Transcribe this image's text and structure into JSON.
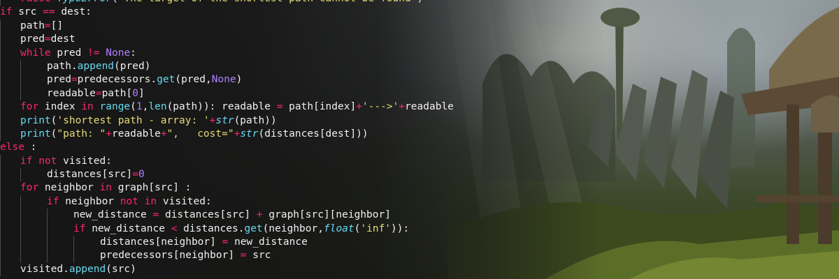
{
  "colors": {
    "keyword": "#f92672",
    "function": "#66d9ef",
    "string": "#e6db74",
    "number": "#ae81ff",
    "text": "#f0f0f0"
  },
  "code": {
    "lines": [
      {
        "indent": 1,
        "tokens": [
          [
            "kw",
            "raise "
          ],
          [
            "bi",
            "TypeError"
          ],
          [
            "txt",
            "("
          ],
          [
            "str",
            "'The target of the shortest path cannot be found'"
          ],
          [
            "txt",
            ")"
          ]
        ]
      },
      {
        "indent": 0,
        "tokens": [
          [
            "kw",
            "if "
          ],
          [
            "txt",
            "src "
          ],
          [
            "op",
            "=="
          ],
          [
            "txt",
            " dest:"
          ]
        ]
      },
      {
        "indent": 1,
        "tokens": [
          [
            "txt",
            "path"
          ],
          [
            "op",
            "="
          ],
          [
            "txt",
            "[]"
          ]
        ]
      },
      {
        "indent": 1,
        "tokens": [
          [
            "txt",
            "pred"
          ],
          [
            "op",
            "="
          ],
          [
            "txt",
            "dest"
          ]
        ]
      },
      {
        "indent": 1,
        "tokens": [
          [
            "kw",
            "while "
          ],
          [
            "txt",
            "pred "
          ],
          [
            "op",
            "!="
          ],
          [
            "txt",
            " "
          ],
          [
            "const",
            "None"
          ],
          [
            "txt",
            ":"
          ]
        ]
      },
      {
        "indent": 2,
        "tokens": [
          [
            "txt",
            "path."
          ],
          [
            "fn",
            "append"
          ],
          [
            "txt",
            "(pred)"
          ]
        ]
      },
      {
        "indent": 2,
        "tokens": [
          [
            "txt",
            "pred"
          ],
          [
            "op",
            "="
          ],
          [
            "txt",
            "predecessors."
          ],
          [
            "fn",
            "get"
          ],
          [
            "txt",
            "(pred,"
          ],
          [
            "const",
            "None"
          ],
          [
            "txt",
            ")"
          ]
        ]
      },
      {
        "indent": 2,
        "tokens": [
          [
            "txt",
            "readable"
          ],
          [
            "op",
            "="
          ],
          [
            "txt",
            "path["
          ],
          [
            "num",
            "0"
          ],
          [
            "txt",
            "]"
          ]
        ]
      },
      {
        "indent": 1,
        "tokens": [
          [
            "kw",
            "for "
          ],
          [
            "txt",
            "index "
          ],
          [
            "kw",
            "in "
          ],
          [
            "fn",
            "range"
          ],
          [
            "txt",
            "("
          ],
          [
            "num",
            "1"
          ],
          [
            "txt",
            ","
          ],
          [
            "fn",
            "len"
          ],
          [
            "txt",
            "(path)): readable "
          ],
          [
            "op",
            "="
          ],
          [
            "txt",
            " path[index]"
          ],
          [
            "op",
            "+"
          ],
          [
            "str",
            "'--->'"
          ],
          [
            "op",
            "+"
          ],
          [
            "txt",
            "readable"
          ]
        ]
      },
      {
        "indent": 1,
        "tokens": [
          [
            "fn",
            "print"
          ],
          [
            "txt",
            "("
          ],
          [
            "str",
            "'shortest path - array: '"
          ],
          [
            "op",
            "+"
          ],
          [
            "bi",
            "str"
          ],
          [
            "txt",
            "(path))"
          ]
        ]
      },
      {
        "indent": 1,
        "tokens": [
          [
            "fn",
            "print"
          ],
          [
            "txt",
            "("
          ],
          [
            "str",
            "\"path: \""
          ],
          [
            "op",
            "+"
          ],
          [
            "txt",
            "readable"
          ],
          [
            "op",
            "+"
          ],
          [
            "str",
            "\",   cost=\""
          ],
          [
            "op",
            "+"
          ],
          [
            "bi",
            "str"
          ],
          [
            "txt",
            "(distances[dest]))"
          ]
        ]
      },
      {
        "indent": 0,
        "tokens": [
          [
            "kw",
            "else "
          ],
          [
            "txt",
            ":"
          ]
        ]
      },
      {
        "indent": 1,
        "tokens": [
          [
            "kw",
            "if not "
          ],
          [
            "txt",
            "visited:"
          ]
        ]
      },
      {
        "indent": 2,
        "tokens": [
          [
            "txt",
            "distances[src]"
          ],
          [
            "op",
            "="
          ],
          [
            "num",
            "0"
          ]
        ]
      },
      {
        "indent": 1,
        "tokens": [
          [
            "kw",
            "for "
          ],
          [
            "txt",
            "neighbor "
          ],
          [
            "kw",
            "in "
          ],
          [
            "txt",
            "graph[src] :"
          ]
        ]
      },
      {
        "indent": 2,
        "tokens": [
          [
            "kw",
            "if "
          ],
          [
            "txt",
            "neighbor "
          ],
          [
            "kw",
            "not in "
          ],
          [
            "txt",
            "visited:"
          ]
        ]
      },
      {
        "indent": 3,
        "tokens": [
          [
            "txt",
            "new_distance "
          ],
          [
            "op",
            "="
          ],
          [
            "txt",
            " distances[src] "
          ],
          [
            "op",
            "+"
          ],
          [
            "txt",
            " graph[src][neighbor]"
          ]
        ]
      },
      {
        "indent": 3,
        "tokens": [
          [
            "kw",
            "if "
          ],
          [
            "txt",
            "new_distance "
          ],
          [
            "op",
            "<"
          ],
          [
            "txt",
            " distances."
          ],
          [
            "fn",
            "get"
          ],
          [
            "txt",
            "(neighbor,"
          ],
          [
            "bi",
            "float"
          ],
          [
            "txt",
            "("
          ],
          [
            "str",
            "'inf'"
          ],
          [
            "txt",
            "))"
          ],
          [
            "txt",
            ":"
          ]
        ]
      },
      {
        "indent": 4,
        "tokens": [
          [
            "txt",
            "distances[neighbor] "
          ],
          [
            "op",
            "="
          ],
          [
            "txt",
            " new_distance"
          ]
        ]
      },
      {
        "indent": 4,
        "tokens": [
          [
            "txt",
            "predecessors[neighbor] "
          ],
          [
            "op",
            "="
          ],
          [
            "txt",
            " src"
          ]
        ]
      },
      {
        "indent": 1,
        "tokens": [
          [
            "txt",
            "visited."
          ],
          [
            "fn",
            "append"
          ],
          [
            "txt",
            "(src)"
          ]
        ]
      }
    ]
  }
}
